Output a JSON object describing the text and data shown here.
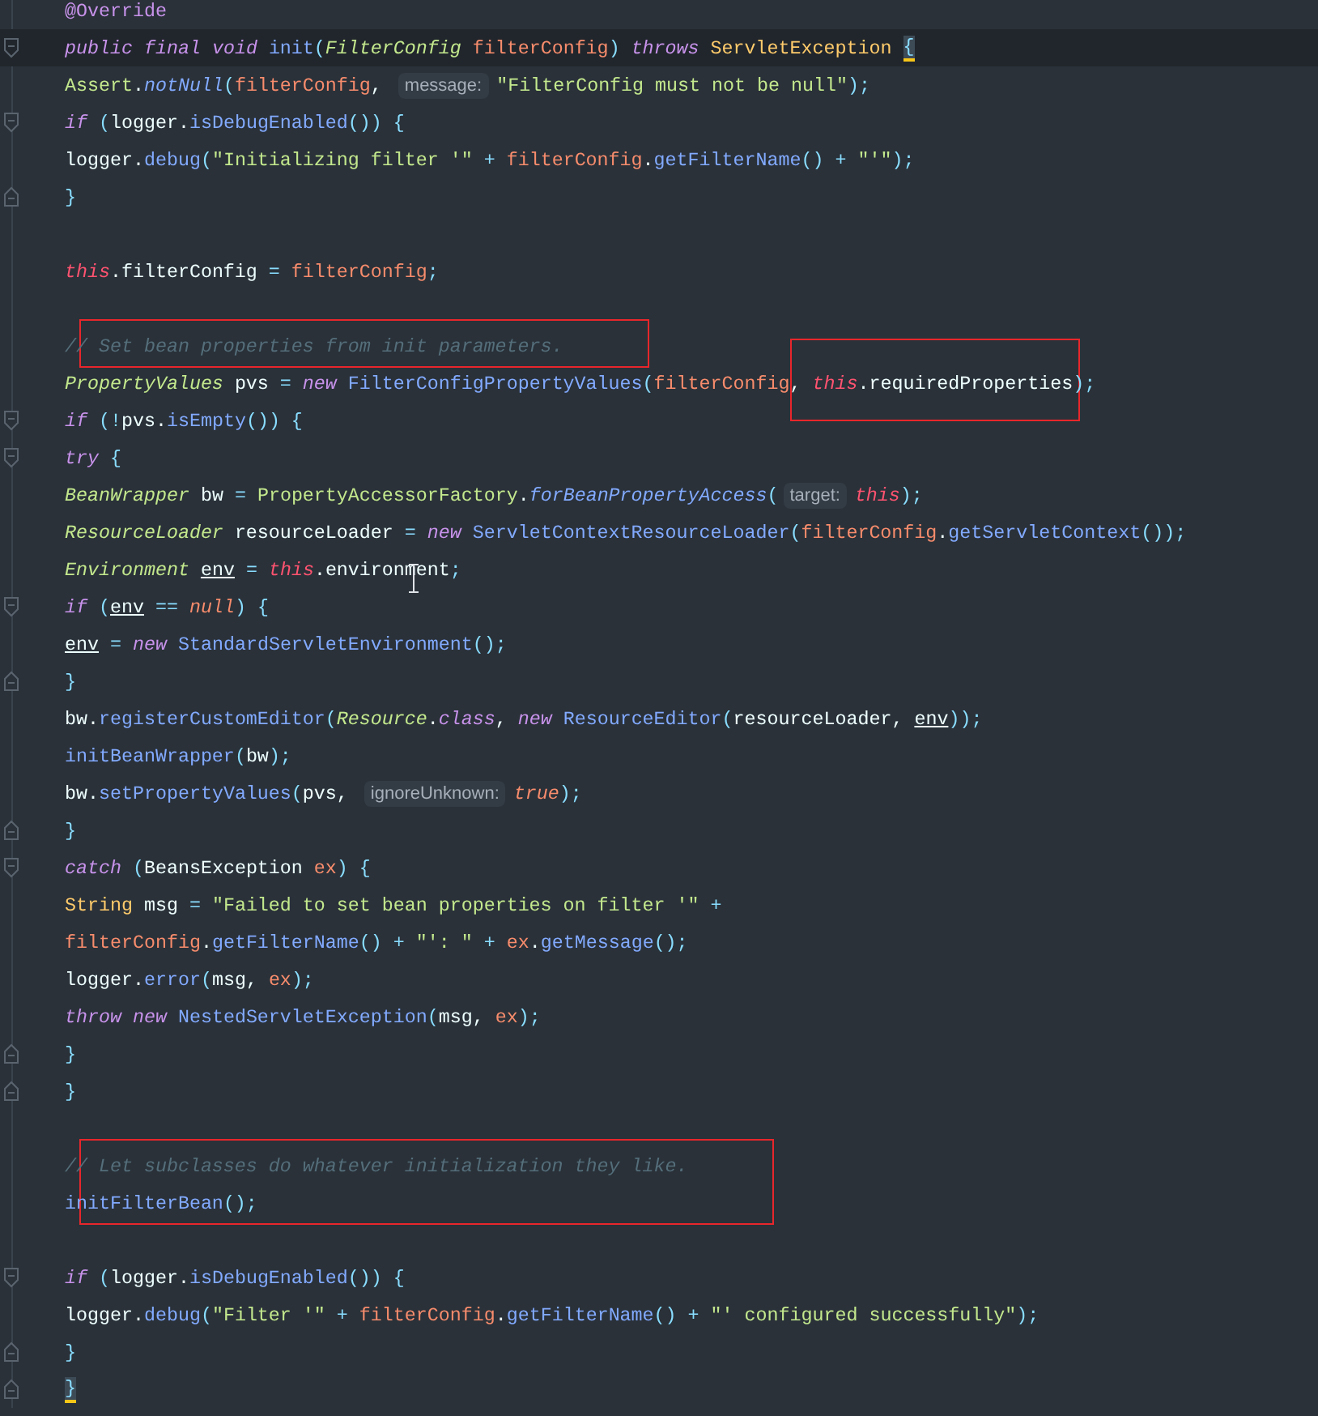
{
  "editor": {
    "lines": [
      {
        "current": false,
        "boxed": false,
        "fold_start": false,
        "fold_end": false,
        "tokens": [
          {
            "text": "@Override",
            "kind": "annotation"
          }
        ]
      },
      {
        "current": true,
        "boxed": false,
        "fold_start": true,
        "fold_end": false,
        "tokens": [
          {
            "text": "public ",
            "kind": "keyword"
          },
          {
            "text": "final ",
            "kind": "keyword"
          },
          {
            "text": "void ",
            "kind": "keyword"
          },
          {
            "text": "init",
            "kind": "method"
          },
          {
            "text": "(",
            "kind": "punct"
          },
          {
            "text": "FilterConfig ",
            "kind": "type"
          },
          {
            "text": "filterConfig",
            "kind": "param"
          },
          {
            "text": ") ",
            "kind": "punct"
          },
          {
            "text": "throws ",
            "kind": "keyword"
          },
          {
            "text": "ServletException ",
            "kind": "class"
          },
          {
            "text": "{",
            "kind": "punct",
            "matched": true
          }
        ]
      },
      {
        "current": false,
        "boxed": false,
        "fold_start": false,
        "fold_end": false,
        "tokens": [
          {
            "text": "    Assert",
            "kind": "library"
          },
          {
            "text": ".",
            "kind": "plain"
          },
          {
            "text": "notNull",
            "kind": "static"
          },
          {
            "text": "(",
            "kind": "punct"
          },
          {
            "text": "filterConfig",
            "kind": "param"
          },
          {
            "text": ", ",
            "kind": "plain"
          },
          {
            "text": "message:",
            "kind": "hint"
          },
          {
            "text": "\"FilterConfig must not be null\"",
            "kind": "string"
          },
          {
            "text": ");",
            "kind": "punct"
          }
        ]
      },
      {
        "current": false,
        "boxed": false,
        "fold_start": true,
        "fold_end": false,
        "tokens": [
          {
            "text": "    if ",
            "kind": "keyword"
          },
          {
            "text": "(",
            "kind": "punct"
          },
          {
            "text": "logger.",
            "kind": "plain"
          },
          {
            "text": "isDebugEnabled",
            "kind": "method"
          },
          {
            "text": "()) {",
            "kind": "punct"
          }
        ]
      },
      {
        "current": false,
        "boxed": false,
        "fold_start": false,
        "fold_end": false,
        "tokens": [
          {
            "text": "        logger.",
            "kind": "plain"
          },
          {
            "text": "debug",
            "kind": "method"
          },
          {
            "text": "(",
            "kind": "punct"
          },
          {
            "text": "\"Initializing filter '\"",
            "kind": "string"
          },
          {
            "text": " + ",
            "kind": "punct"
          },
          {
            "text": "filterConfig",
            "kind": "param"
          },
          {
            "text": ".",
            "kind": "plain"
          },
          {
            "text": "getFilterName",
            "kind": "method"
          },
          {
            "text": "() + ",
            "kind": "punct"
          },
          {
            "text": "\"'\"",
            "kind": "string"
          },
          {
            "text": ");",
            "kind": "punct"
          }
        ]
      },
      {
        "current": false,
        "boxed": false,
        "fold_start": false,
        "fold_end": true,
        "tokens": [
          {
            "text": "    }",
            "kind": "punct"
          }
        ]
      },
      {
        "current": false,
        "boxed": false,
        "fold_start": false,
        "fold_end": false
      },
      {
        "current": false,
        "boxed": false,
        "fold_start": false,
        "fold_end": false,
        "tokens": [
          {
            "text": "    this",
            "kind": "self"
          },
          {
            "text": ".filterConfig ",
            "kind": "plain"
          },
          {
            "text": "= ",
            "kind": "punct"
          },
          {
            "text": "filterConfig",
            "kind": "param"
          },
          {
            "text": ";",
            "kind": "punct"
          }
        ]
      },
      {
        "current": false,
        "boxed": false,
        "fold_start": false,
        "fold_end": false
      },
      {
        "current": false,
        "boxed": true,
        "fold_start": false,
        "fold_end": false,
        "tokens": [
          {
            "text": "    // Set bean properties from init parameters.",
            "kind": "comment"
          }
        ]
      },
      {
        "current": false,
        "boxed": false,
        "fold_start": false,
        "fold_end": false,
        "tokens": [
          {
            "text": "    PropertyValues ",
            "kind": "type"
          },
          {
            "text": "pvs ",
            "kind": "plain"
          },
          {
            "text": "= ",
            "kind": "punct"
          },
          {
            "text": "new ",
            "kind": "keyword"
          },
          {
            "text": "FilterConfigPropertyValues",
            "kind": "method"
          },
          {
            "text": "(",
            "kind": "punct"
          },
          {
            "text": "filterConfig",
            "kind": "param"
          },
          {
            "text": ", ",
            "kind": "plain"
          },
          {
            "text": "this",
            "kind": "self",
            "boxed": true
          },
          {
            "text": ".requiredProperties",
            "kind": "plain",
            "boxed": true
          },
          {
            "text": ");",
            "kind": "punct"
          }
        ]
      },
      {
        "current": false,
        "boxed": false,
        "fold_start": true,
        "fold_end": false,
        "tokens": [
          {
            "text": "    if ",
            "kind": "keyword"
          },
          {
            "text": "(!",
            "kind": "punct"
          },
          {
            "text": "pvs.",
            "kind": "plain"
          },
          {
            "text": "isEmpty",
            "kind": "method"
          },
          {
            "text": "()) {",
            "kind": "punct"
          }
        ]
      },
      {
        "current": false,
        "boxed": false,
        "fold_start": true,
        "fold_end": false,
        "tokens": [
          {
            "text": "        try ",
            "kind": "keyword"
          },
          {
            "text": "{",
            "kind": "punct"
          }
        ]
      },
      {
        "current": false,
        "boxed": false,
        "fold_start": false,
        "fold_end": false,
        "tokens": [
          {
            "text": "            BeanWrapper ",
            "kind": "type"
          },
          {
            "text": "bw ",
            "kind": "plain"
          },
          {
            "text": "= ",
            "kind": "punct"
          },
          {
            "text": "PropertyAccessorFactory",
            "kind": "library"
          },
          {
            "text": ".",
            "kind": "plain"
          },
          {
            "text": "forBeanPropertyAccess",
            "kind": "static"
          },
          {
            "text": "(",
            "kind": "punct"
          },
          {
            "text": "target:",
            "kind": "hint"
          },
          {
            "text": "this",
            "kind": "self"
          },
          {
            "text": ");",
            "kind": "punct"
          }
        ]
      },
      {
        "current": false,
        "boxed": false,
        "fold_start": false,
        "fold_end": false,
        "tokens": [
          {
            "text": "            ResourceLoader ",
            "kind": "type"
          },
          {
            "text": "resourceLoader ",
            "kind": "plain"
          },
          {
            "text": "= ",
            "kind": "punct"
          },
          {
            "text": "new ",
            "kind": "keyword"
          },
          {
            "text": "ServletContextResourceLoader",
            "kind": "method"
          },
          {
            "text": "(",
            "kind": "punct"
          },
          {
            "text": "filterConfig",
            "kind": "param"
          },
          {
            "text": ".",
            "kind": "plain"
          },
          {
            "text": "getServletContext",
            "kind": "method"
          },
          {
            "text": "());",
            "kind": "punct"
          }
        ]
      },
      {
        "current": false,
        "boxed": false,
        "fold_start": false,
        "fold_end": false,
        "tokens": [
          {
            "text": "            Environment ",
            "kind": "type"
          },
          {
            "text": "env",
            "kind": "reassigned"
          },
          {
            "text": " = ",
            "kind": "punct"
          },
          {
            "text": "this",
            "kind": "self"
          },
          {
            "text": ".",
            "kind": "plain"
          },
          {
            "text": "environment",
            "kind": "plain",
            "hovered": true
          },
          {
            "text": ";",
            "kind": "punct"
          }
        ]
      },
      {
        "current": false,
        "boxed": false,
        "fold_start": true,
        "fold_end": false,
        "tokens": [
          {
            "text": "            if ",
            "kind": "keyword"
          },
          {
            "text": "(",
            "kind": "punct"
          },
          {
            "text": "env",
            "kind": "reassigned"
          },
          {
            "text": " == ",
            "kind": "punct"
          },
          {
            "text": "null",
            "kind": "literal"
          },
          {
            "text": ") {",
            "kind": "punct"
          }
        ]
      },
      {
        "current": false,
        "boxed": false,
        "fold_start": false,
        "fold_end": false,
        "tokens": [
          {
            "text": "                env",
            "kind": "reassigned"
          },
          {
            "text": " = ",
            "kind": "punct"
          },
          {
            "text": "new ",
            "kind": "keyword"
          },
          {
            "text": "StandardServletEnvironment",
            "kind": "method"
          },
          {
            "text": "();",
            "kind": "punct"
          }
        ]
      },
      {
        "current": false,
        "boxed": false,
        "fold_start": false,
        "fold_end": true,
        "tokens": [
          {
            "text": "            }",
            "kind": "punct"
          }
        ]
      },
      {
        "current": false,
        "boxed": false,
        "fold_start": false,
        "fold_end": false,
        "tokens": [
          {
            "text": "            bw.",
            "kind": "plain"
          },
          {
            "text": "registerCustomEditor",
            "kind": "method"
          },
          {
            "text": "(",
            "kind": "punct"
          },
          {
            "text": "Resource",
            "kind": "type"
          },
          {
            "text": ".",
            "kind": "plain"
          },
          {
            "text": "class",
            "kind": "keyword"
          },
          {
            "text": ", ",
            "kind": "plain"
          },
          {
            "text": "new ",
            "kind": "keyword"
          },
          {
            "text": "ResourceEditor",
            "kind": "method"
          },
          {
            "text": "(",
            "kind": "punct"
          },
          {
            "text": "resourceLoader, ",
            "kind": "plain"
          },
          {
            "text": "env",
            "kind": "reassigned"
          },
          {
            "text": "));",
            "kind": "punct"
          }
        ]
      },
      {
        "current": false,
        "boxed": false,
        "fold_start": false,
        "fold_end": false,
        "tokens": [
          {
            "text": "            initBeanWrapper",
            "kind": "method"
          },
          {
            "text": "(",
            "kind": "punct"
          },
          {
            "text": "bw",
            "kind": "plain"
          },
          {
            "text": ");",
            "kind": "punct"
          }
        ]
      },
      {
        "current": false,
        "boxed": false,
        "fold_start": false,
        "fold_end": false,
        "tokens": [
          {
            "text": "            bw.",
            "kind": "plain"
          },
          {
            "text": "setPropertyValues",
            "kind": "method"
          },
          {
            "text": "(",
            "kind": "punct"
          },
          {
            "text": "pvs, ",
            "kind": "plain"
          },
          {
            "text": "ignoreUnknown:",
            "kind": "hint"
          },
          {
            "text": "true",
            "kind": "literal"
          },
          {
            "text": ");",
            "kind": "punct"
          }
        ]
      },
      {
        "current": false,
        "boxed": false,
        "fold_start": false,
        "fold_end": true,
        "tokens": [
          {
            "text": "        }",
            "kind": "punct"
          }
        ]
      },
      {
        "current": false,
        "boxed": false,
        "fold_start": true,
        "fold_end": false,
        "tokens": [
          {
            "text": "        catch ",
            "kind": "keyword"
          },
          {
            "text": "(",
            "kind": "punct"
          },
          {
            "text": "BeansException ",
            "kind": "plain"
          },
          {
            "text": "ex",
            "kind": "param"
          },
          {
            "text": ") {",
            "kind": "punct"
          }
        ]
      },
      {
        "current": false,
        "boxed": false,
        "fold_start": false,
        "fold_end": false,
        "tokens": [
          {
            "text": "            String ",
            "kind": "class"
          },
          {
            "text": "msg ",
            "kind": "plain"
          },
          {
            "text": "= ",
            "kind": "punct"
          },
          {
            "text": "\"Failed to set bean properties on filter '\"",
            "kind": "string"
          },
          {
            "text": " +",
            "kind": "punct"
          }
        ]
      },
      {
        "current": false,
        "boxed": false,
        "fold_start": false,
        "fold_end": false,
        "tokens": [
          {
            "text": "                filterConfig",
            "kind": "param"
          },
          {
            "text": ".",
            "kind": "plain"
          },
          {
            "text": "getFilterName",
            "kind": "method"
          },
          {
            "text": "() + ",
            "kind": "punct"
          },
          {
            "text": "\"': \"",
            "kind": "string"
          },
          {
            "text": " + ",
            "kind": "punct"
          },
          {
            "text": "ex",
            "kind": "param"
          },
          {
            "text": ".",
            "kind": "plain"
          },
          {
            "text": "getMessage",
            "kind": "method"
          },
          {
            "text": "();",
            "kind": "punct"
          }
        ]
      },
      {
        "current": false,
        "boxed": false,
        "fold_start": false,
        "fold_end": false,
        "tokens": [
          {
            "text": "            logger.",
            "kind": "plain"
          },
          {
            "text": "error",
            "kind": "method"
          },
          {
            "text": "(",
            "kind": "punct"
          },
          {
            "text": "msg, ",
            "kind": "plain"
          },
          {
            "text": "ex",
            "kind": "param"
          },
          {
            "text": ");",
            "kind": "punct"
          }
        ]
      },
      {
        "current": false,
        "boxed": false,
        "fold_start": false,
        "fold_end": false,
        "tokens": [
          {
            "text": "            throw ",
            "kind": "keyword"
          },
          {
            "text": "new ",
            "kind": "keyword"
          },
          {
            "text": "NestedServletException",
            "kind": "method"
          },
          {
            "text": "(",
            "kind": "punct"
          },
          {
            "text": "msg, ",
            "kind": "plain"
          },
          {
            "text": "ex",
            "kind": "param"
          },
          {
            "text": ");",
            "kind": "punct"
          }
        ]
      },
      {
        "current": false,
        "boxed": false,
        "fold_start": false,
        "fold_end": true,
        "tokens": [
          {
            "text": "        }",
            "kind": "punct"
          }
        ]
      },
      {
        "current": false,
        "boxed": false,
        "fold_start": false,
        "fold_end": true,
        "tokens": [
          {
            "text": "    }",
            "kind": "punct"
          }
        ]
      },
      {
        "current": false,
        "boxed": false,
        "fold_start": false,
        "fold_end": false
      },
      {
        "current": false,
        "boxed": true,
        "fold_start": false,
        "fold_end": false,
        "tokens": [
          {
            "text": "    // Let subclasses do whatever initialization they like.",
            "kind": "comment"
          }
        ]
      },
      {
        "current": false,
        "boxed": true,
        "fold_start": false,
        "fold_end": false,
        "tokens": [
          {
            "text": "    initFilterBean",
            "kind": "method"
          },
          {
            "text": "();",
            "kind": "punct"
          }
        ]
      },
      {
        "current": false,
        "boxed": false,
        "fold_start": false,
        "fold_end": false
      },
      {
        "current": false,
        "boxed": false,
        "fold_start": true,
        "fold_end": false,
        "tokens": [
          {
            "text": "    if ",
            "kind": "keyword"
          },
          {
            "text": "(",
            "kind": "punct"
          },
          {
            "text": "logger.",
            "kind": "plain"
          },
          {
            "text": "isDebugEnabled",
            "kind": "method"
          },
          {
            "text": "()) {",
            "kind": "punct"
          }
        ]
      },
      {
        "current": false,
        "boxed": false,
        "fold_start": false,
        "fold_end": false,
        "tokens": [
          {
            "text": "        logger.",
            "kind": "plain"
          },
          {
            "text": "debug",
            "kind": "method"
          },
          {
            "text": "(",
            "kind": "punct"
          },
          {
            "text": "\"Filter '\"",
            "kind": "string"
          },
          {
            "text": " + ",
            "kind": "punct"
          },
          {
            "text": "filterConfig",
            "kind": "param"
          },
          {
            "text": ".",
            "kind": "plain"
          },
          {
            "text": "getFilterName",
            "kind": "method"
          },
          {
            "text": "() + ",
            "kind": "punct"
          },
          {
            "text": "\"' configured successfully\"",
            "kind": "string"
          },
          {
            "text": ");",
            "kind": "punct"
          }
        ]
      },
      {
        "current": false,
        "boxed": false,
        "fold_start": false,
        "fold_end": true,
        "tokens": [
          {
            "text": "    }",
            "kind": "punct"
          }
        ]
      },
      {
        "current": false,
        "boxed": false,
        "fold_start": false,
        "fold_end": true,
        "tokens": [
          {
            "text": "}",
            "kind": "punct",
            "matched": true
          }
        ]
      }
    ]
  }
}
